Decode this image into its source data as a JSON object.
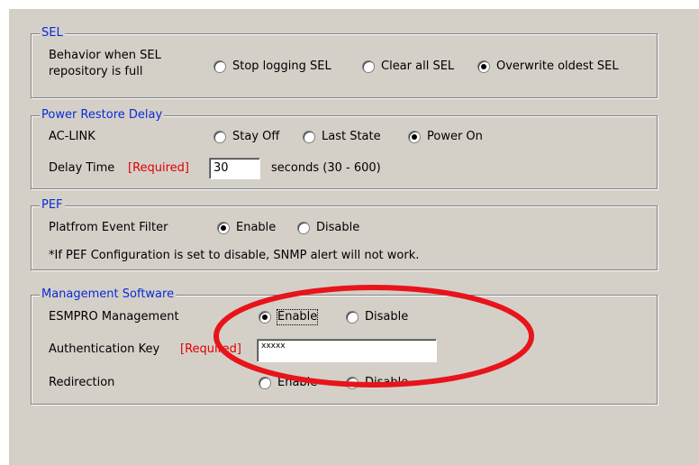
{
  "sel": {
    "legend": "SEL",
    "behavior_label_1": "Behavior when SEL",
    "behavior_label_2": "repository is full",
    "options": [
      "Stop logging SEL",
      "Clear all SEL",
      "Overwrite oldest SEL"
    ],
    "selected": "Overwrite oldest SEL"
  },
  "power_restore": {
    "legend": "Power Restore Delay",
    "ac_link_label": "AC-LINK",
    "ac_link_options": [
      "Stay Off",
      "Last State",
      "Power On"
    ],
    "ac_link_selected": "Power On",
    "delay_label": "Delay Time",
    "required_tag": "[Required]",
    "delay_value": "30",
    "delay_hint": "seconds (30 - 600)"
  },
  "pef": {
    "legend": "PEF",
    "filter_label": "Platfrom Event Filter",
    "options": [
      "Enable",
      "Disable"
    ],
    "selected": "Enable",
    "note": "*If PEF Configuration is set to disable, SNMP alert will not work."
  },
  "management": {
    "legend": "Management Software",
    "esmpro_label": "ESMPRO Management",
    "esmpro_options": [
      "Enable",
      "Disable"
    ],
    "esmpro_selected": "Enable",
    "auth_label": "Authentication Key",
    "required_tag": "[Required]",
    "auth_value": "xxxxx",
    "redirection_label": "Redirection",
    "redirection_options": [
      "Enable",
      "Disable"
    ],
    "redirection_selected": "none"
  },
  "annotation": {
    "color": "#e8141b",
    "shape": "ellipse"
  },
  "colors": {
    "panel": "#d4d0c8",
    "legend_text": "#0a2bd6",
    "required_text": "#e00000"
  }
}
